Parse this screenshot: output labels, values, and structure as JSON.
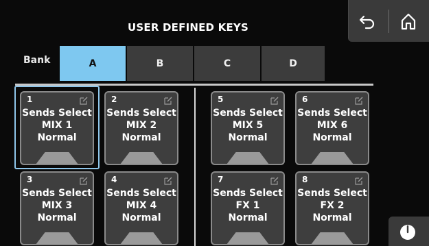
{
  "header": {
    "title": "USER DEFINED KEYS"
  },
  "nav": {
    "back_icon": "back-arrow-icon",
    "home_icon": "home-icon"
  },
  "bank": {
    "label": "Bank",
    "tabs": [
      {
        "label": "A",
        "active": true
      },
      {
        "label": "B",
        "active": false
      },
      {
        "label": "C",
        "active": false
      },
      {
        "label": "D",
        "active": false
      }
    ]
  },
  "keys": [
    {
      "number": "1",
      "line1": "Sends Select",
      "line2": "MIX 1",
      "line3": "Normal",
      "selected": true
    },
    {
      "number": "2",
      "line1": "Sends Select",
      "line2": "MIX 2",
      "line3": "Normal"
    },
    {
      "number": "5",
      "line1": "Sends Select",
      "line2": "MIX 5",
      "line3": "Normal"
    },
    {
      "number": "6",
      "line1": "Sends Select",
      "line2": "MIX 6",
      "line3": "Normal"
    },
    {
      "number": "3",
      "line1": "Sends Select",
      "line2": "MIX 3",
      "line3": "Normal"
    },
    {
      "number": "4",
      "line1": "Sends Select",
      "line2": "MIX 4",
      "line3": "Normal"
    },
    {
      "number": "7",
      "line1": "Sends Select",
      "line2": "FX 1",
      "line3": "Normal"
    },
    {
      "number": "8",
      "line1": "Sends Select",
      "line2": "FX 2",
      "line3": "Normal"
    }
  ],
  "colors": {
    "active_tab": "#7ec8f0",
    "selected_outline": "#8fc6ea",
    "key_bg": "#3e3e3e"
  }
}
